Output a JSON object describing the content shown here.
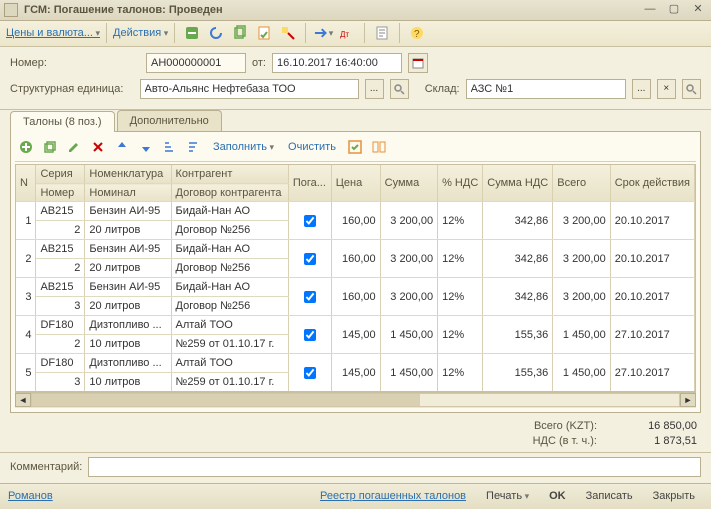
{
  "titlebar": {
    "title": "ГСМ: Погашение талонов: Проведен"
  },
  "toolbar": {
    "prices": "Цены и валюта...",
    "actions": "Действия"
  },
  "form": {
    "number_label": "Номер:",
    "number": "АН000000001",
    "ot_label": "от:",
    "date": "16.10.2017 16:40:00",
    "unit_label": "Структурная единица:",
    "unit": "Авто-Альянс Нефтебаза ТОО",
    "warehouse_label": "Склад:",
    "warehouse": "АЗС №1"
  },
  "tabs": {
    "t1": "Талоны (8 поз.)",
    "t2": "Дополнительно"
  },
  "gridbar": {
    "fill": "Заполнить",
    "clear": "Очистить"
  },
  "headers": {
    "n": "N",
    "series": "Серия",
    "nomen": "Номенклатура",
    "contr": "Контрагент",
    "poga": "Пога...",
    "price": "Цена",
    "sum": "Сумма",
    "vatp": "% НДС",
    "vatsum": "Сумма НДС",
    "total": "Всего",
    "expiry": "Срок действия",
    "number": "Номер",
    "nominal": "Номинал",
    "dogovor": "Договор контрагента"
  },
  "rows": [
    {
      "n": "1",
      "series": "AB215",
      "nomen": "Бензин АИ-95",
      "contr": "Бидай-Нан АО",
      "number": "2",
      "nominal": "20 литров",
      "dogovor": "Договор №256",
      "poga": true,
      "price": "160,00",
      "sum": "3 200,00",
      "vatp": "12%",
      "vatsum": "342,86",
      "total": "3 200,00",
      "expiry": "20.10.2017"
    },
    {
      "n": "2",
      "series": "AB215",
      "nomen": "Бензин АИ-95",
      "contr": "Бидай-Нан АО",
      "number": "2",
      "nominal": "20 литров",
      "dogovor": "Договор №256",
      "poga": true,
      "price": "160,00",
      "sum": "3 200,00",
      "vatp": "12%",
      "vatsum": "342,86",
      "total": "3 200,00",
      "expiry": "20.10.2017"
    },
    {
      "n": "3",
      "series": "AB215",
      "nomen": "Бензин АИ-95",
      "contr": "Бидай-Нан АО",
      "number": "3",
      "nominal": "20 литров",
      "dogovor": "Договор №256",
      "poga": true,
      "price": "160,00",
      "sum": "3 200,00",
      "vatp": "12%",
      "vatsum": "342,86",
      "total": "3 200,00",
      "expiry": "20.10.2017"
    },
    {
      "n": "4",
      "series": "DF180",
      "nomen": "Дизтопливо ...",
      "contr": "Алтай ТОО",
      "number": "2",
      "nominal": "10 литров",
      "dogovor": "№259 от 01.10.17 г.",
      "poga": true,
      "price": "145,00",
      "sum": "1 450,00",
      "vatp": "12%",
      "vatsum": "155,36",
      "total": "1 450,00",
      "expiry": "27.10.2017"
    },
    {
      "n": "5",
      "series": "DF180",
      "nomen": "Дизтопливо ...",
      "contr": "Алтай ТОО",
      "number": "3",
      "nominal": "10 литров",
      "dogovor": "№259 от 01.10.17 г.",
      "poga": true,
      "price": "145,00",
      "sum": "1 450,00",
      "vatp": "12%",
      "vatsum": "155,36",
      "total": "1 450,00",
      "expiry": "27.10.2017"
    }
  ],
  "totals": {
    "total_lbl": "Всего (KZT):",
    "total_val": "16 850,00",
    "vat_lbl": "НДС (в т. ч.):",
    "vat_val": "1 873,51"
  },
  "comment": {
    "label": "Комментарий:",
    "value": ""
  },
  "footer": {
    "user": "Романов",
    "registry": "Реестр погашенных талонов",
    "print": "Печать",
    "ok": "OK",
    "save": "Записать",
    "close": "Закрыть"
  }
}
